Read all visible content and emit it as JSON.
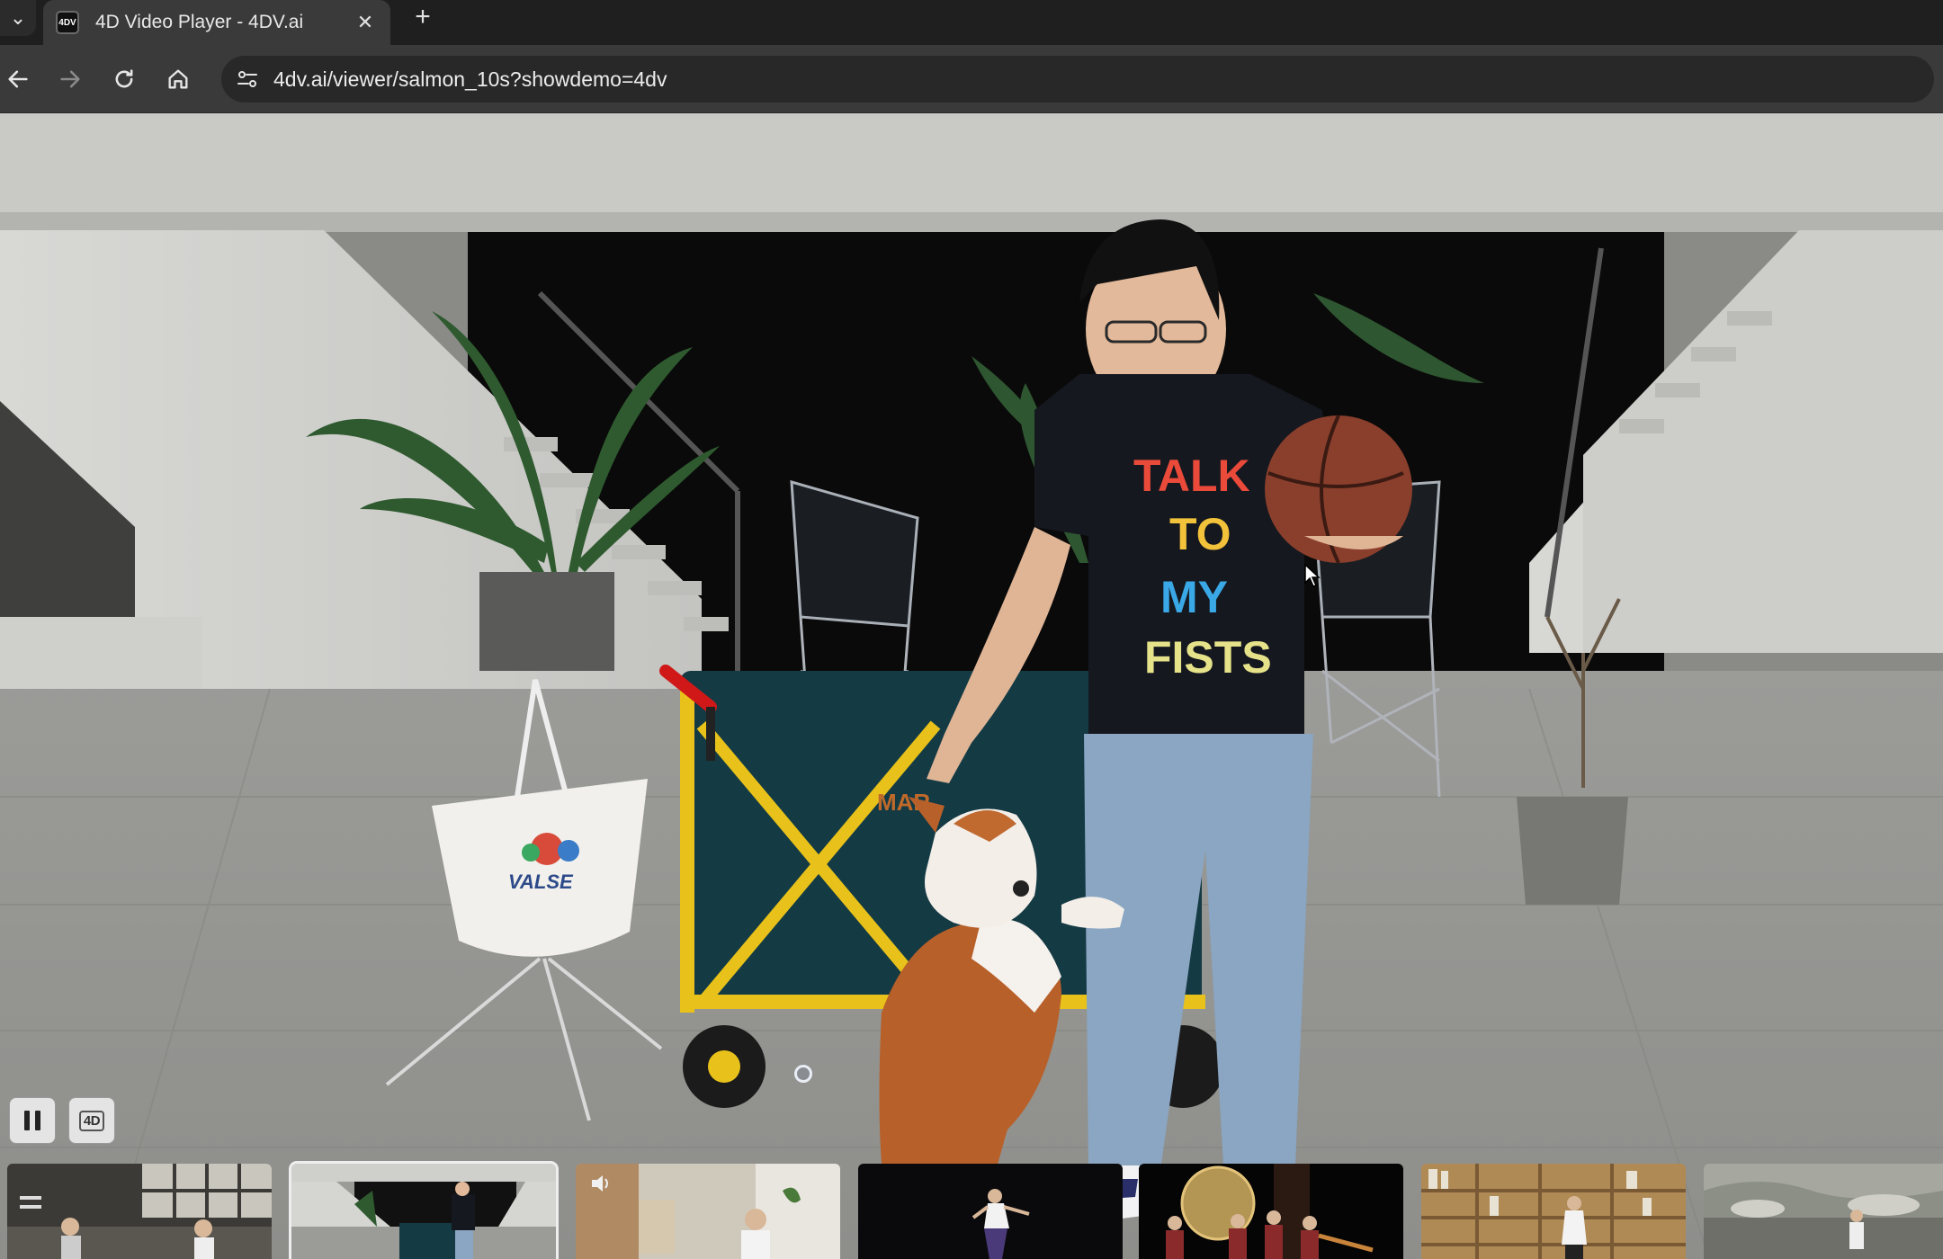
{
  "browser": {
    "tab": {
      "title": "4D Video Player - 4DV.ai",
      "favicon": "4DV",
      "close_icon": "close-icon"
    },
    "new_tab_label": "+",
    "nav": {
      "back_icon": "arrow-left-icon",
      "forward_icon": "arrow-right-icon",
      "reload_icon": "reload-icon",
      "home_icon": "home-icon"
    },
    "address_bar": {
      "url": "4dv.ai/viewer/salmon_10s?showdemo=4dv",
      "site_info_icon": "site-settings-icon"
    }
  },
  "viewer": {
    "shirt_text": [
      "TALK",
      "TO",
      "MY",
      "FISTS"
    ],
    "bag_logo": "VALSE",
    "wagon_logo": "MAR",
    "controls": {
      "pause_icon": "pause-icon",
      "mode_label": "4D"
    }
  },
  "thumbnails": [
    {
      "scene": "workshop-interior"
    },
    {
      "scene": "courtyard-dog",
      "active": true
    },
    {
      "scene": "living-room-speaker",
      "has_audio_icon": true
    },
    {
      "scene": "dancer-dark-stage"
    },
    {
      "scene": "band-performance-moon"
    },
    {
      "scene": "bookshelf-performer"
    },
    {
      "scene": "outdoor-rocks"
    }
  ],
  "colors": {
    "tabstrip": "#1f1f1f",
    "toolbar": "#3a3a3a",
    "omnibox": "#282828",
    "text": "#ececec"
  }
}
